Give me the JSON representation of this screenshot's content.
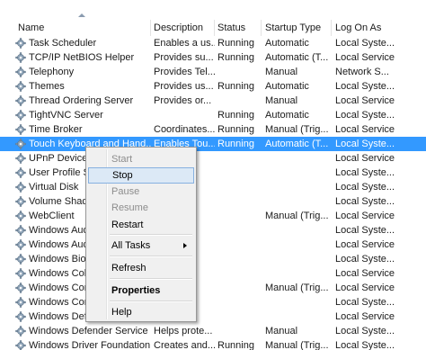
{
  "table": {
    "columns": [
      "Name",
      "Description",
      "Status",
      "Startup Type",
      "Log On As"
    ],
    "rows": [
      {
        "name": "Task Scheduler",
        "desc": "Enables a us...",
        "status": "Running",
        "startup": "Automatic",
        "logon": "Local Syste..."
      },
      {
        "name": "TCP/IP NetBIOS Helper",
        "desc": "Provides su...",
        "status": "Running",
        "startup": "Automatic (T...",
        "logon": "Local Service"
      },
      {
        "name": "Telephony",
        "desc": "Provides Tel...",
        "status": "",
        "startup": "Manual",
        "logon": "Network S..."
      },
      {
        "name": "Themes",
        "desc": "Provides us...",
        "status": "Running",
        "startup": "Automatic",
        "logon": "Local Syste..."
      },
      {
        "name": "Thread Ordering Server",
        "desc": "Provides or...",
        "status": "",
        "startup": "Manual",
        "logon": "Local Service"
      },
      {
        "name": "TightVNC Server",
        "desc": "",
        "status": "Running",
        "startup": "Automatic",
        "logon": "Local Syste..."
      },
      {
        "name": "Time Broker",
        "desc": "Coordinates...",
        "status": "Running",
        "startup": "Manual (Trig...",
        "logon": "Local Service"
      },
      {
        "name": "Touch Keyboard and Hand...",
        "desc": "Enables Tou...",
        "status": "Running",
        "startup": "Automatic (T...",
        "logon": "Local Syste..."
      },
      {
        "name": "UPnP Device H",
        "desc": "",
        "status": "",
        "startup": "",
        "logon": "Local Service"
      },
      {
        "name": "User Profile Se",
        "desc": "",
        "status": "",
        "startup": "",
        "logon": "Local Syste..."
      },
      {
        "name": "Virtual Disk",
        "desc": "",
        "status": "",
        "startup": "",
        "logon": "Local Syste..."
      },
      {
        "name": "Volume Shado",
        "desc": "",
        "status": "",
        "startup": "",
        "logon": "Local Syste..."
      },
      {
        "name": "WebClient",
        "desc": "",
        "status": "",
        "startup": "Manual (Trig...",
        "logon": "Local Service"
      },
      {
        "name": "Windows Aud",
        "desc": "",
        "status": "",
        "startup": "",
        "logon": "Local Syste..."
      },
      {
        "name": "Windows Aud",
        "desc": "",
        "status": "",
        "startup": "",
        "logon": "Local Service"
      },
      {
        "name": "Windows Biom",
        "desc": "",
        "status": "",
        "startup": "",
        "logon": "Local Syste..."
      },
      {
        "name": "Windows Colo",
        "desc": "",
        "status": "",
        "startup": "",
        "logon": "Local Service"
      },
      {
        "name": "Windows Con",
        "desc": "",
        "status": "",
        "startup": "Manual (Trig...",
        "logon": "Local Service"
      },
      {
        "name": "Windows Con",
        "desc": "",
        "status": "",
        "startup": "",
        "logon": "Local Syste..."
      },
      {
        "name": "Windows Defender Network...",
        "desc": "",
        "status": "",
        "startup": "",
        "logon": "Local Service"
      },
      {
        "name": "Windows Defender Service",
        "desc": "Helps prote...",
        "status": "",
        "startup": "Manual",
        "logon": "Local Syste..."
      },
      {
        "name": "Windows Driver Foundation...",
        "desc": "Creates and...",
        "status": "Running",
        "startup": "Manual (Trig...",
        "logon": "Local Syste..."
      }
    ],
    "selected_index": 7
  },
  "context_menu": {
    "items": [
      {
        "label": "Start",
        "disabled": true
      },
      {
        "label": "Stop",
        "disabled": false,
        "hover": true
      },
      {
        "label": "Pause",
        "disabled": true
      },
      {
        "label": "Resume",
        "disabled": true
      },
      {
        "label": "Restart",
        "disabled": false
      },
      {
        "label": "All Tasks",
        "disabled": false,
        "submenu": true
      },
      {
        "label": "Refresh",
        "disabled": false
      },
      {
        "label": "Properties",
        "disabled": false,
        "bold": true
      },
      {
        "label": "Help",
        "disabled": false
      }
    ]
  },
  "colors": {
    "selection": "#3399ff",
    "menu_hover": "#dce9f6"
  },
  "icons": {
    "row_icon": "gear-icon",
    "sort_indicator": "sort-ascending-icon",
    "submenu_arrow": "chevron-right-icon"
  }
}
